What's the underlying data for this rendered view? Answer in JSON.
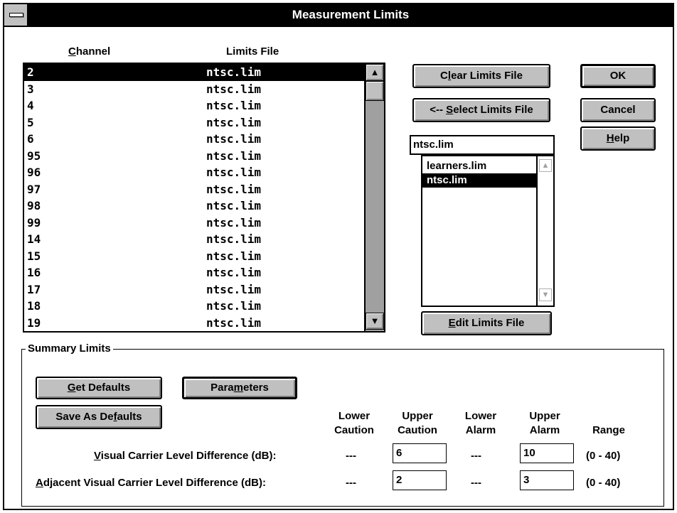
{
  "window": {
    "title": "Measurement Limits"
  },
  "channel_list": {
    "col_channel": "Channel",
    "col_channel_mnemonic": "C",
    "col_channel_rest": "hannel",
    "col_limits_file": "Limits File",
    "rows": [
      {
        "channel": "2",
        "file": "ntsc.lim"
      },
      {
        "channel": "3",
        "file": "ntsc.lim"
      },
      {
        "channel": "4",
        "file": "ntsc.lim"
      },
      {
        "channel": "5",
        "file": "ntsc.lim"
      },
      {
        "channel": "6",
        "file": "ntsc.lim"
      },
      {
        "channel": "95",
        "file": "ntsc.lim"
      },
      {
        "channel": "96",
        "file": "ntsc.lim"
      },
      {
        "channel": "97",
        "file": "ntsc.lim"
      },
      {
        "channel": "98",
        "file": "ntsc.lim"
      },
      {
        "channel": "99",
        "file": "ntsc.lim"
      },
      {
        "channel": "14",
        "file": "ntsc.lim"
      },
      {
        "channel": "15",
        "file": "ntsc.lim"
      },
      {
        "channel": "16",
        "file": "ntsc.lim"
      },
      {
        "channel": "17",
        "file": "ntsc.lim"
      },
      {
        "channel": "18",
        "file": "ntsc.lim"
      },
      {
        "channel": "19",
        "file": "ntsc.lim"
      }
    ],
    "selected_index": 0
  },
  "buttons": {
    "clear_pre": "C",
    "clear_mn": "l",
    "clear_post": "ear Limits File",
    "select_pre": "<-- ",
    "select_mn": "S",
    "select_post": "elect Limits File",
    "edit_pre": "",
    "edit_mn": "E",
    "edit_post": "dit Limits File",
    "ok": "OK",
    "cancel": "Cancel",
    "help_mn": "H",
    "help_post": "elp",
    "get_mn": "G",
    "get_post": "et Defaults",
    "params_pre": "Para",
    "params_mn": "m",
    "params_post": "eters",
    "save_pre": "Save As De",
    "save_mn": "f",
    "save_post": "aults"
  },
  "limits_file_picker": {
    "value": "ntsc.lim",
    "options": [
      "learners.lim",
      "ntsc.lim"
    ],
    "selected_index": 1
  },
  "summary_limits": {
    "label": "Summary Limits",
    "columns": {
      "lower_caution_1": "Lower",
      "lower_caution_2": "Caution",
      "upper_caution_1": "Upper",
      "upper_caution_2": "Caution",
      "lower_alarm_1": "Lower",
      "lower_alarm_2": "Alarm",
      "upper_alarm_1": "Upper",
      "upper_alarm_2": "Alarm",
      "range": "Range"
    },
    "rows": [
      {
        "label_mn": "V",
        "label_rest": "isual Carrier Level Difference (dB):",
        "lower_caution": "---",
        "upper_caution": "6",
        "lower_alarm": "---",
        "upper_alarm": "10",
        "range": "(0 - 40)"
      },
      {
        "label_mn": "A",
        "label_rest": "djacent Visual Carrier Level Difference (dB):",
        "lower_caution": "---",
        "upper_caution": "2",
        "lower_alarm": "---",
        "upper_alarm": "3",
        "range": "(0 - 40)"
      }
    ]
  },
  "icons": {
    "system_menu": "system-menu-icon",
    "scroll_up": "up-arrow-icon",
    "scroll_down": "down-arrow-icon"
  },
  "colors": {
    "title_bar": "#000000",
    "button_face": "#c0c0c0",
    "scroll_track": "#a0a0a0",
    "selection": "#000000"
  }
}
